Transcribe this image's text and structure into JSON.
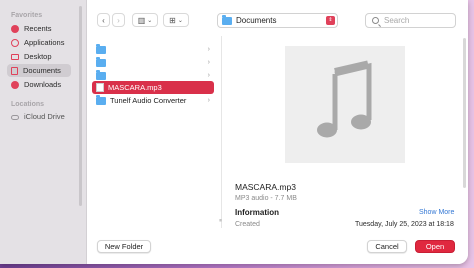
{
  "sidebar": {
    "favorites_label": "Favorites",
    "locations_label": "Locations",
    "items": [
      {
        "label": "Recents",
        "icon": "clock-icon"
      },
      {
        "label": "Applications",
        "icon": "applications-icon"
      },
      {
        "label": "Desktop",
        "icon": "desktop-icon"
      },
      {
        "label": "Documents",
        "icon": "document-icon",
        "selected": true
      },
      {
        "label": "Downloads",
        "icon": "download-icon"
      }
    ],
    "locations": [
      {
        "label": "iCloud Drive",
        "icon": "cloud-icon"
      }
    ]
  },
  "toolbar": {
    "back": "‹",
    "forward": "›",
    "view_mode": "▥",
    "group_mode": "⊞",
    "dropdown": "⌄",
    "location": "Documents",
    "search_placeholder": "Search"
  },
  "files": [
    {
      "name": "",
      "kind": "folder"
    },
    {
      "name": "",
      "kind": "folder"
    },
    {
      "name": "",
      "kind": "folder"
    },
    {
      "name": "MASCARA.mp3",
      "kind": "file",
      "selected": true
    },
    {
      "name": "Tunelf Audio Converter",
      "kind": "folder"
    }
  ],
  "preview": {
    "filename": "MASCARA.mp3",
    "meta": "MP3 audio - 7.7 MB",
    "info_heading": "Information",
    "show_more": "Show More",
    "created_label": "Created",
    "created_value": "Tuesday, July 25, 2023 at 18:18"
  },
  "footer": {
    "new_folder": "New Folder",
    "cancel": "Cancel",
    "open": "Open"
  },
  "colors": {
    "accent": "#e0283f",
    "folder": "#5aaef0"
  }
}
